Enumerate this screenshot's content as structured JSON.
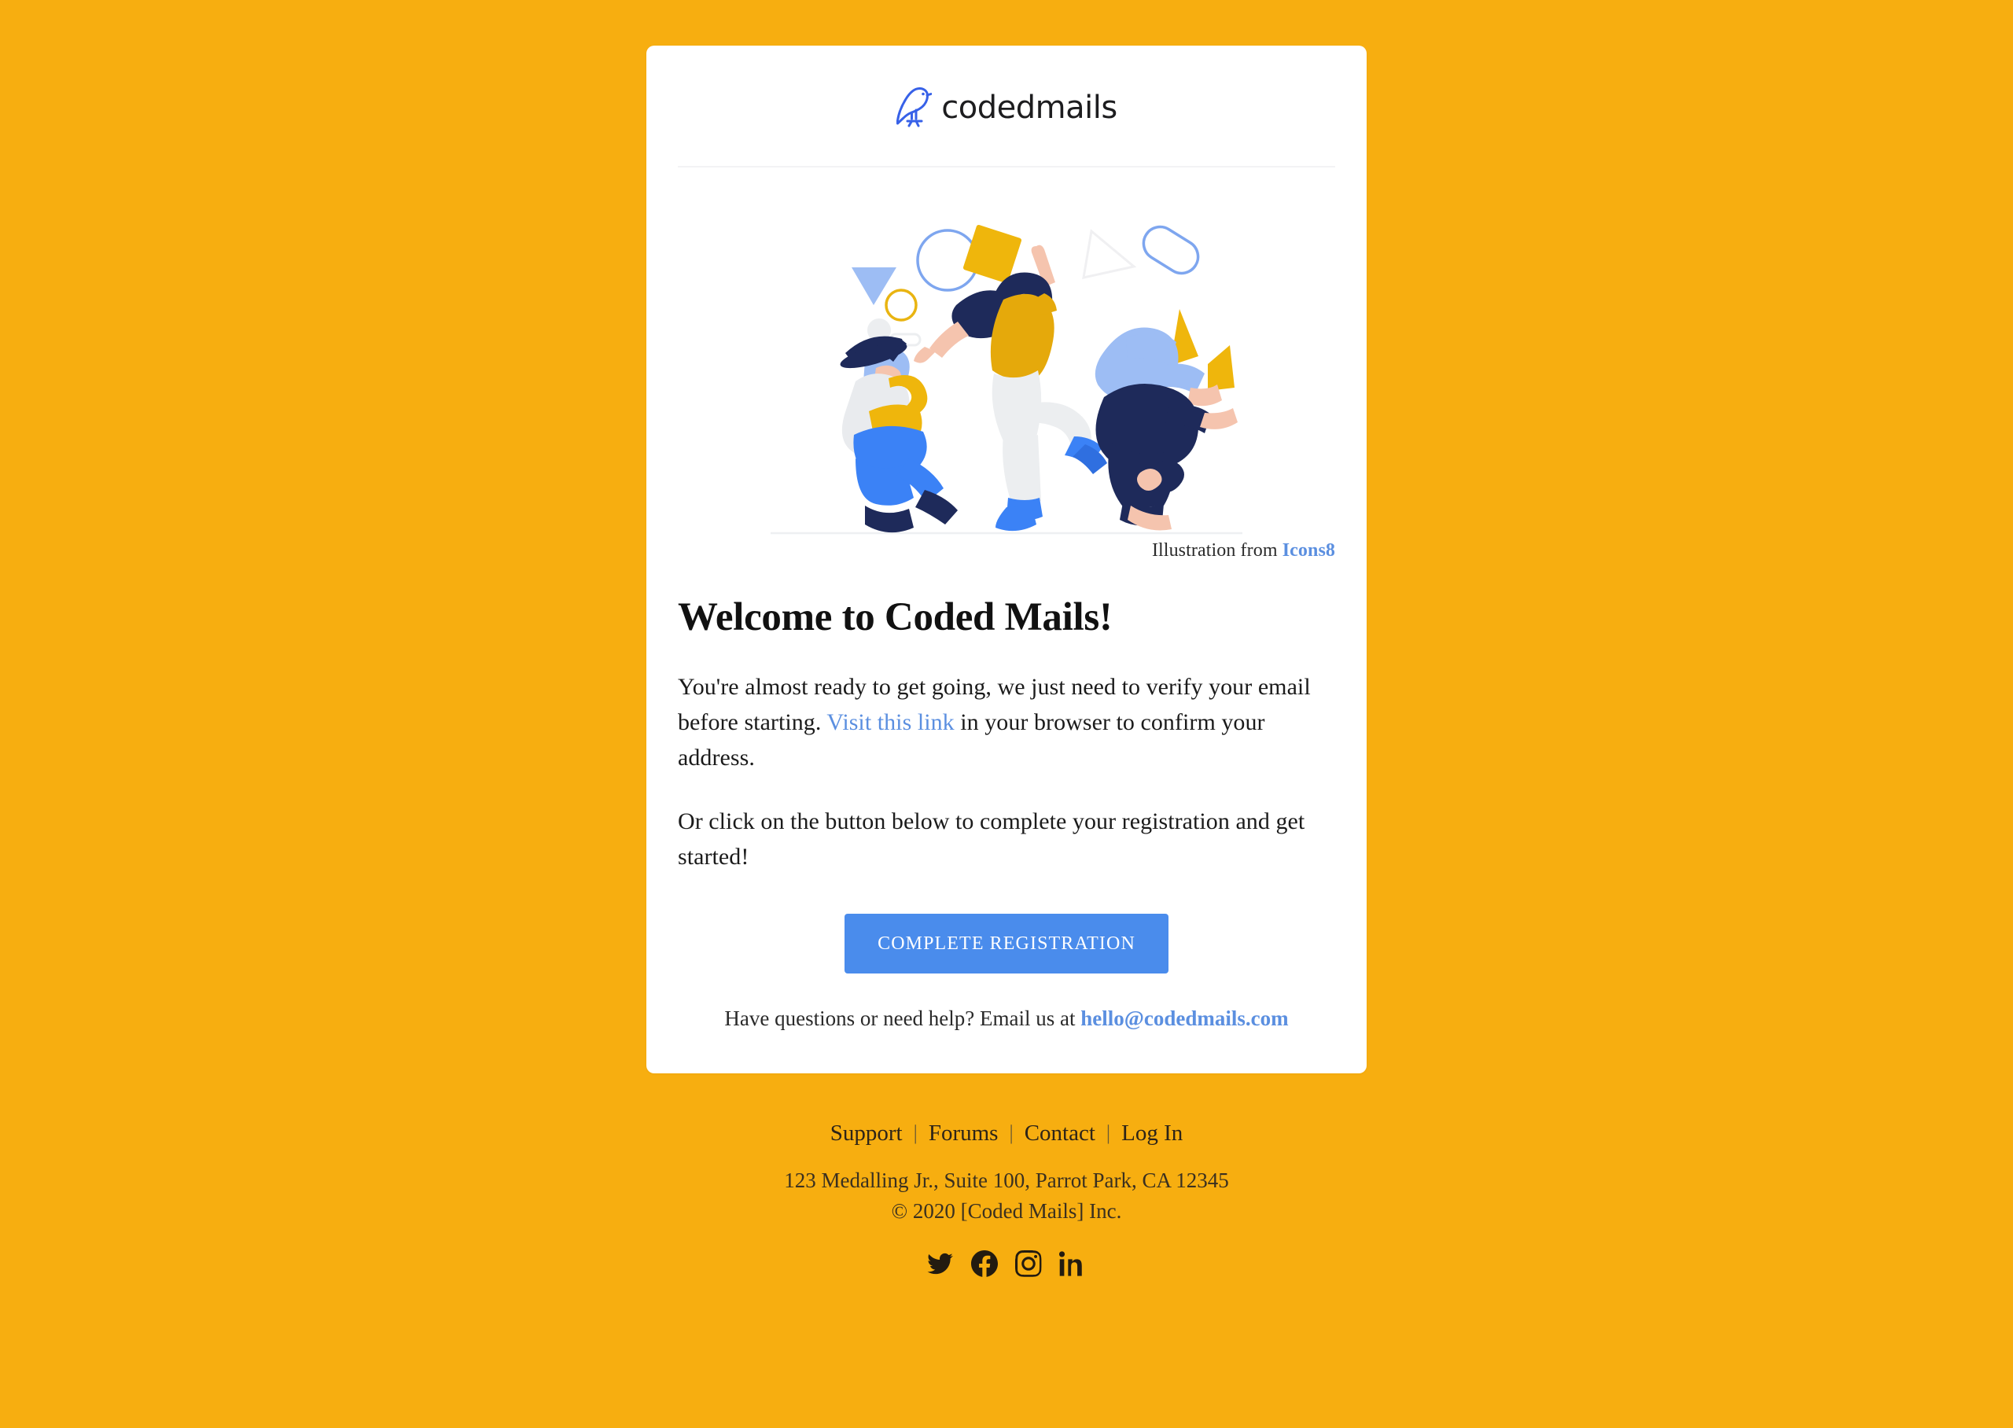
{
  "theme": {
    "background_color": "#f7ae10",
    "card_background": "#ffffff",
    "link_color": "#5b8fe0",
    "button_color": "#4a8cec",
    "logo_color": "#3761e8",
    "footer_text_color": "#3a3020"
  },
  "header": {
    "brand_name": "codedmails",
    "logo_icon": "bird-logo-icon"
  },
  "illustration": {
    "credit_prefix": "Illustration from ",
    "credit_link": "Icons8",
    "alt": "three dancing people with floating geometric shapes"
  },
  "main": {
    "title": "Welcome to Coded Mails!",
    "paragraph_1": {
      "before_link": "You're almost ready to get going, we just need to verify your email before starting. ",
      "link": "Visit this link",
      "after_link": " in your browser to confirm your address."
    },
    "paragraph_2": "Or click on the button below to complete your registration and get started!",
    "cta_label": "COMPLETE REGISTRATION",
    "help": {
      "text": "Have questions or need help? Email us at ",
      "email": "hello@codedmails.com"
    }
  },
  "footer": {
    "links": [
      {
        "label": "Support"
      },
      {
        "label": "Forums"
      },
      {
        "label": "Contact"
      },
      {
        "label": "Log In"
      }
    ],
    "separator": "|",
    "address": "123 Medalling Jr., Suite 100, Parrot Park, CA 12345",
    "copyright": "© 2020 [Coded Mails] Inc.",
    "socials": [
      {
        "name": "twitter-icon"
      },
      {
        "name": "facebook-icon"
      },
      {
        "name": "instagram-icon"
      },
      {
        "name": "linkedin-icon"
      }
    ]
  }
}
